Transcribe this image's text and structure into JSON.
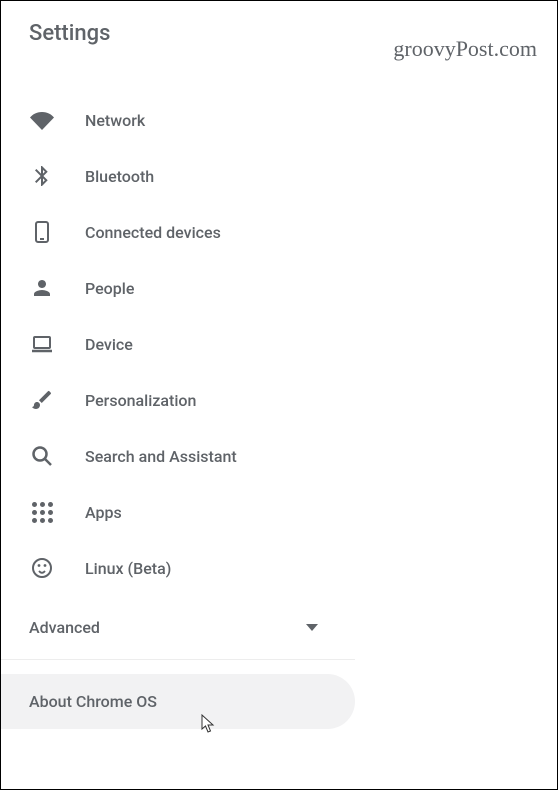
{
  "header": {
    "title": "Settings",
    "watermark": "groovyPost.com"
  },
  "nav": [
    {
      "icon": "wifi-icon",
      "label": "Network"
    },
    {
      "icon": "bluetooth-icon",
      "label": "Bluetooth"
    },
    {
      "icon": "devices-icon",
      "label": "Connected devices"
    },
    {
      "icon": "person-icon",
      "label": "People"
    },
    {
      "icon": "laptop-icon",
      "label": "Device"
    },
    {
      "icon": "brush-icon",
      "label": "Personalization"
    },
    {
      "icon": "search-icon",
      "label": "Search and Assistant"
    },
    {
      "icon": "apps-icon",
      "label": "Apps"
    },
    {
      "icon": "linux-icon",
      "label": "Linux (Beta)"
    }
  ],
  "advanced": {
    "label": "Advanced"
  },
  "about": {
    "label": "About Chrome OS"
  }
}
